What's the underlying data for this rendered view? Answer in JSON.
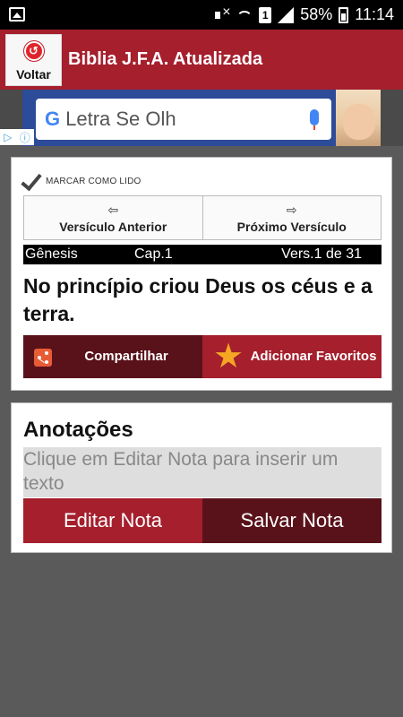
{
  "status_bar": {
    "battery": "58%",
    "time": "11:14",
    "sim_label": "1",
    "icons": [
      "gallery-icon",
      "mute-icon",
      "wifi-icon",
      "sim-icon",
      "signal-icon",
      "battery-icon"
    ]
  },
  "header": {
    "back_label": "Voltar",
    "title": "Biblia J.F.A. Atualizada"
  },
  "ad": {
    "search_text": "Letra Se Olh",
    "google_letter": "G"
  },
  "verse_card": {
    "mark_read_label": "MARCAR COMO LIDO",
    "prev_label": "Versículo Anterior",
    "next_label": "Próximo Versículo",
    "book": "Gênesis",
    "chapter": "Cap.1",
    "verse_counter": "Vers.1 de 31",
    "verse_text": "No princípio criou Deus os céus e a terra.",
    "share_label": "Compartilhar",
    "favorite_label": "Adicionar Favoritos"
  },
  "notes_card": {
    "title": "Anotações",
    "placeholder": "Clique em Editar Nota para inserir um texto",
    "edit_label": "Editar Nota",
    "save_label": "Salvar Nota"
  },
  "colors": {
    "primary_red": "#a51f2d",
    "dark_red": "#5a121a",
    "background": "#5a5a5a"
  }
}
